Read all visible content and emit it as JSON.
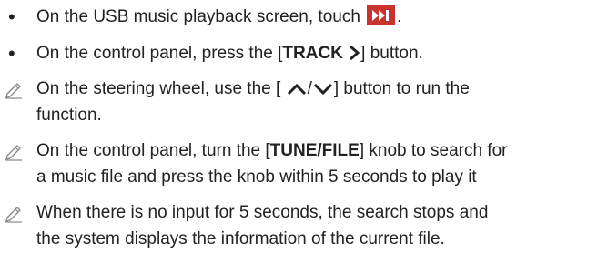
{
  "items": [
    {
      "type": "bullet",
      "before": "On the USB music playback screen, touch",
      "icon": "next-track-icon",
      "after": "."
    },
    {
      "type": "bullet",
      "before": "On the control panel, press the [",
      "bold": "TRACK",
      "icon": "chevron-right-icon",
      "after": "] button."
    },
    {
      "type": "note",
      "icon": "pencil-icon",
      "line1_before": "On the steering wheel, use the [",
      "icons": [
        "chevron-up-icon",
        "chevron-down-icon"
      ],
      "separator": "/",
      "line1_after": "] button to run the",
      "line2": "function."
    },
    {
      "type": "note",
      "icon": "pencil-icon",
      "line1_before": "On the control panel, turn the [",
      "bold": "TUNE/FILE",
      "line1_after": "] knob to search for",
      "line2": "a music file and press the knob within 5 seconds to play it"
    },
    {
      "type": "note",
      "icon": "pencil-icon",
      "line1": "When there is no input for 5 seconds, the search stops and",
      "line2": "the system displays the information of the current file."
    }
  ],
  "colors": {
    "text": "#222222",
    "icon_bg": "#c8332d",
    "note_icon": "#8a8a8a"
  }
}
